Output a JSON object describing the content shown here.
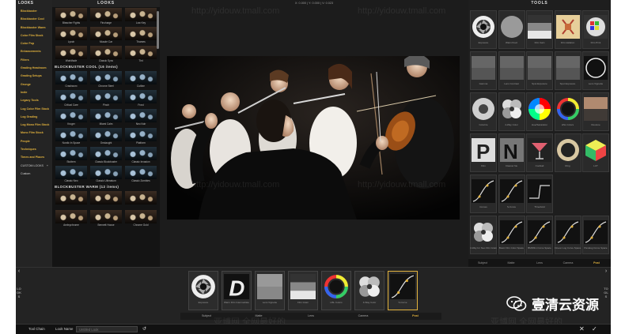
{
  "looks_panel": {
    "categories_title": "LOOKS",
    "categories": [
      "Blockbuster",
      "Blockbuster Cool",
      "Blockbuster Warm",
      "Color Film Stock",
      "Color Pop",
      "Enhancements",
      "Filters",
      "Grading Headroom",
      "Grading Setups",
      "Grunge",
      "Indie",
      "Legacy Tools",
      "Log Color Film Stock",
      "Log Grading",
      "Log Mono Film Stock",
      "Mono Film Stock",
      "People",
      "Techniques",
      "Times and Places"
    ],
    "custom_looks_label": "CUSTOM LOOKS",
    "custom_looks_add": "+",
    "custom_items": [
      "Custom"
    ],
    "title": "LOOKS",
    "top_rows": [
      [
        "Bleacher Fights",
        "Fincharge",
        "Low Key"
      ],
      [
        "Lynch",
        "Muscle Car",
        "Thames"
      ],
      [
        "Worldfade",
        "Classic Sync",
        "Tint"
      ]
    ],
    "section_cool": "BLOCKBUSTER COOL (16 items)",
    "cool_rows": [
      [
        "Crashworx",
        "Chrome Steel",
        "Cutline"
      ],
      [
        "Critical Care",
        "Pinch",
        "Frost"
      ],
      [
        "Kruger",
        "Miami Calm",
        "Neo Noir"
      ],
      [
        "Nordic In Space",
        "Onslaught",
        "Platform"
      ],
      [
        "Stuttern",
        "Classic Blockbuster",
        "Classic Invasion"
      ],
      [
        "Classic Neo",
        "Classic Ultimatum",
        "Classic Zombies"
      ]
    ],
    "section_warm": "BLOCKBUSTER WARM (12 items)",
    "warm_rows": [
      [
        "",
        "",
        ""
      ],
      [
        "Ambrychrome",
        "Bennett House",
        "Chrome Gold"
      ]
    ]
  },
  "viewer": {
    "readout": "X: 0.000 | Y: 0.000 | V: 0.023"
  },
  "tools_panel": {
    "title": "TOOLS",
    "tools": [
      {
        "label": "Exposure",
        "icon": "aperture-icon"
      },
      {
        "label": "Warm/Cool",
        "icon": "warm-cool-icon"
      },
      {
        "label": "Film Gain",
        "icon": "film-gain-icon"
      },
      {
        "label": "Film Halation",
        "icon": "halation-icon"
      },
      {
        "label": "Film Print",
        "icon": "film-print-icon"
      },
      {
        "label": "Gamma",
        "icon": "gamma-icon"
      },
      {
        "label": "Lens Contrast",
        "icon": "lens-contrast-icon"
      },
      {
        "label": "Spot Exposure",
        "icon": "spot-exposure-icon"
      },
      {
        "label": "Spot Exposure",
        "icon": "spot-exposure-2-icon"
      },
      {
        "label": "Lens Vignette",
        "icon": "vignette-icon"
      },
      {
        "label": "Colorize",
        "icon": "colorize-icon"
      },
      {
        "label": "4-Way Color",
        "icon": "four-way-color-icon"
      },
      {
        "label": "Hue/Saturation",
        "icon": "hue-saturation-icon"
      },
      {
        "label": "HSL Colors",
        "icon": "hsl-colors-icon"
      },
      {
        "label": "Duotone",
        "icon": "duotone-icon"
      },
      {
        "label": "Film",
        "icon": "film-icon"
      },
      {
        "label": "Cleaner Ne",
        "icon": "cleaner-icon"
      },
      {
        "label": "Cocktail",
        "icon": "cocktail-icon"
      },
      {
        "label": "Ring",
        "icon": "ring-icon"
      },
      {
        "label": "LUT",
        "icon": "lut-cube-icon"
      },
      {
        "label": "Curves",
        "icon": "curves-icon"
      },
      {
        "label": "S-Curve",
        "icon": "s-curve-icon"
      },
      {
        "label": "Threshold",
        "icon": "threshold-icon"
      },
      {
        "label": "",
        "icon": "empty-slot"
      },
      {
        "label": "",
        "icon": "empty-slot"
      },
      {
        "label": "4-Way for Neo Film Grain",
        "icon": "four-way-neo-icon"
      },
      {
        "label": "Basic Film Color Space",
        "icon": "basic-film-curve-icon"
      },
      {
        "label": "BMDfilm Curve Space",
        "icon": "bmd-curve-icon"
      },
      {
        "label": "Cineon Log Curve Space",
        "icon": "cineon-curve-icon"
      },
      {
        "label": "Panalog Curve Space",
        "icon": "panalog-curve-icon"
      }
    ],
    "tabs": [
      "Subject",
      "Matte",
      "Lens",
      "Camera",
      "Post"
    ],
    "active_tab": "Post"
  },
  "tool_chain": {
    "left_label": "LOOKS",
    "right_label": "TOOLS",
    "items": [
      {
        "label": "Exposure",
        "icon": "aperture-icon"
      },
      {
        "label": "Warm Film Intermediate",
        "icon": "letter-d-icon"
      },
      {
        "label": "Lens Vignette",
        "icon": "gradient-square-icon"
      },
      {
        "label": "Film Grain",
        "icon": "gradient-square-2-icon"
      },
      {
        "label": "HSL Colors",
        "icon": "hsl-colors-icon"
      },
      {
        "label": "4-Way Color",
        "icon": "four-way-color-icon"
      },
      {
        "label": "S-Curve",
        "icon": "s-curve-icon"
      }
    ],
    "active_item": "S-Curve",
    "tabs": [
      "Subject",
      "Matte",
      "Lens",
      "Camera",
      "Post"
    ],
    "active_tab": "Post"
  },
  "bottom_bar": {
    "tool_chain_label": "Tool Chain",
    "look_name_label": "Look Name",
    "look_name_placeholder": "Untitled Look",
    "reset_icon": "↺",
    "cancel_icon": "✕",
    "confirm_icon": "✓"
  },
  "watermarks": {
    "url": "http://yidouw.tmall.com",
    "cn_text": "亚博网 全网最好的",
    "brand": "壹清云资源"
  },
  "colors": {
    "accent": "#e2b23d",
    "panel": "#1e1e1e",
    "background": "#1a1a1a"
  }
}
